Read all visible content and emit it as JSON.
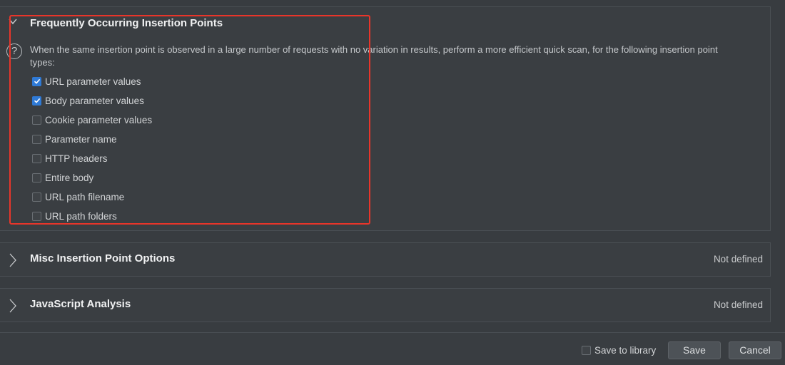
{
  "sections": {
    "freq": {
      "title": "Frequently Occurring Insertion Points",
      "description": "When the same insertion point is observed in a large number of requests with no variation in results, perform a more efficient quick scan, for the following insertion point types:",
      "options": [
        {
          "label": "URL parameter values",
          "checked": true
        },
        {
          "label": "Body parameter values",
          "checked": true
        },
        {
          "label": "Cookie parameter values",
          "checked": false
        },
        {
          "label": "Parameter name",
          "checked": false
        },
        {
          "label": "HTTP headers",
          "checked": false
        },
        {
          "label": "Entire body",
          "checked": false
        },
        {
          "label": "URL path filename",
          "checked": false
        },
        {
          "label": "URL path folders",
          "checked": false
        }
      ]
    },
    "misc": {
      "title": "Misc Insertion Point Options",
      "status": "Not defined"
    },
    "js": {
      "title": "JavaScript Analysis",
      "status": "Not defined"
    }
  },
  "footer": {
    "save_to_library_label": "Save to library",
    "save_to_library_checked": false,
    "save_label": "Save",
    "cancel_label": "Cancel"
  },
  "colors": {
    "accent": "#2f7ad6",
    "highlight": "#e8352a",
    "background": "#383c40"
  }
}
